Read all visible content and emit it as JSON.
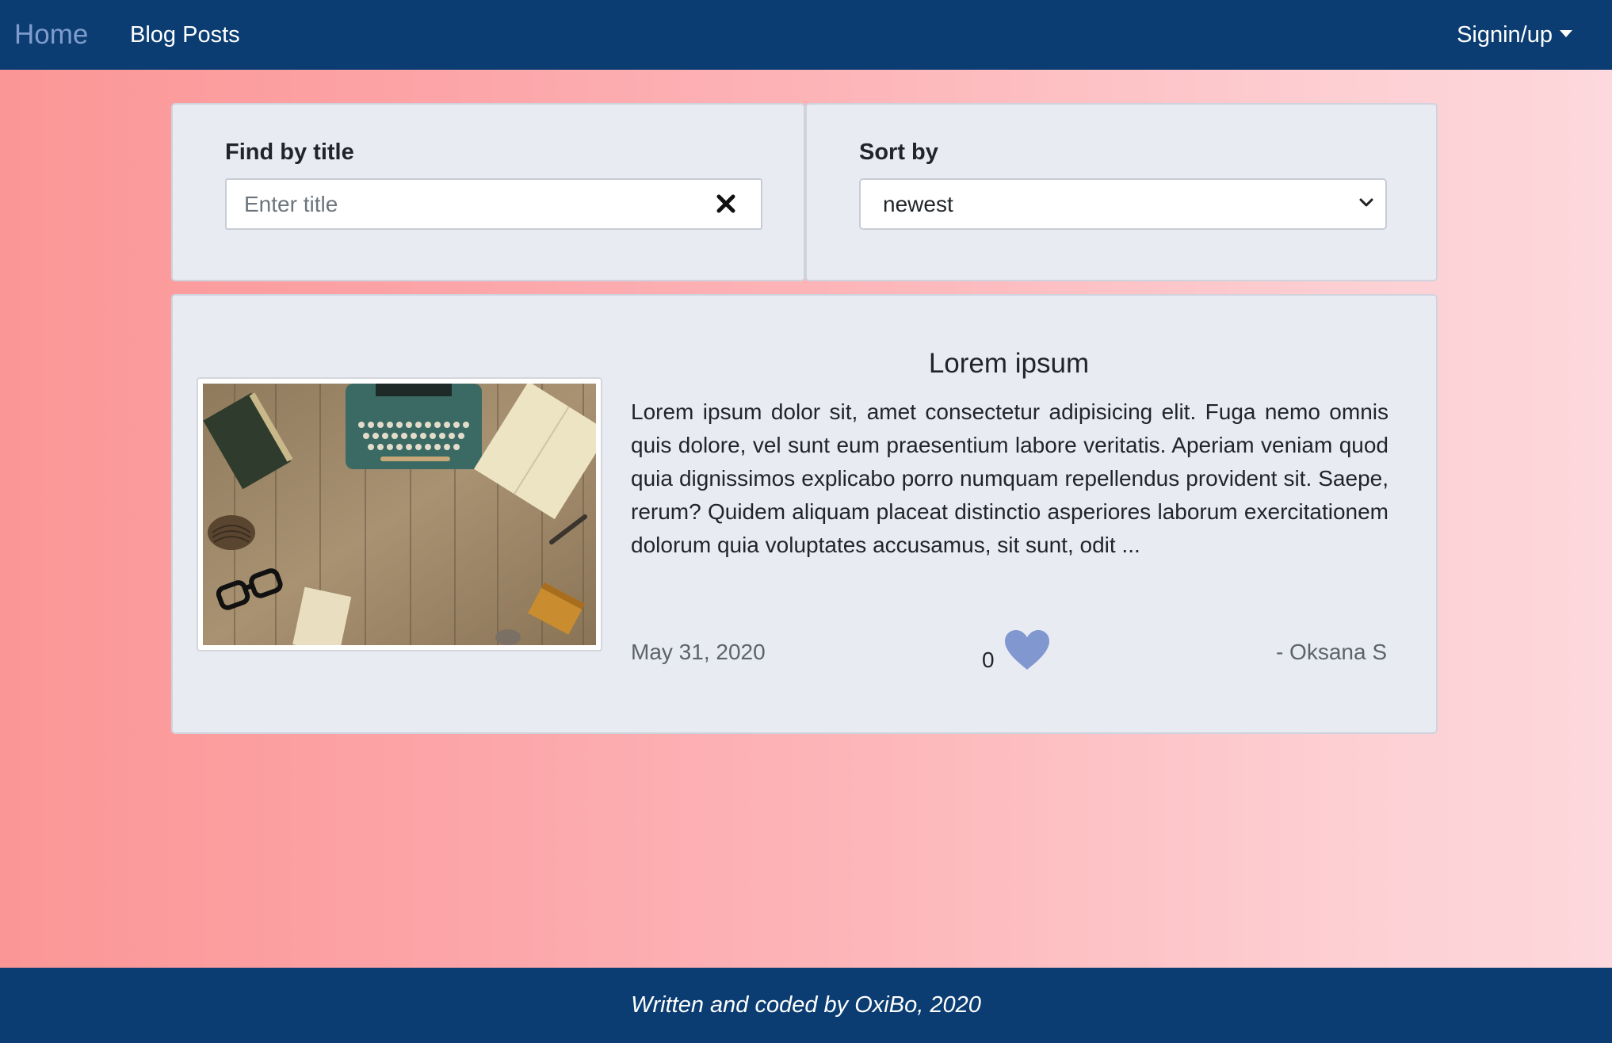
{
  "navbar": {
    "home_label": "Home",
    "posts_label": "Blog Posts",
    "signin_label": "Signin/up"
  },
  "filters": {
    "find_label": "Find by title",
    "find_placeholder": "Enter title",
    "find_value": "",
    "sort_label": "Sort by",
    "sort_value": "newest"
  },
  "post": {
    "title": "Lorem ipsum",
    "excerpt": "Lorem ipsum dolor sit, amet consectetur adipisicing elit. Fuga nemo omnis quis dolore, vel sunt eum praesentium labore veritatis. Aperiam veniam quod quia dignissimos explicabo porro numquam repellendus provident sit. Saepe, rerum? Quidem aliquam placeat distinctio asperiores laborum exercitationem dolorum quia voluptates accusamus, sit sunt, odit ...",
    "date": "May 31, 2020",
    "likes": "0",
    "author": "- Oksana S",
    "image": "typewriter-desk-photo"
  },
  "footer": {
    "text": "Written and coded by OxiBo, 2020"
  },
  "colors": {
    "navbar_bg": "#0b3d72",
    "card_bg": "#e9ebf3",
    "home_link": "#7f9ccd",
    "heart": "#8097cf"
  },
  "icons": {
    "clear": "close-icon",
    "sort_dropdown": "chevron-down-icon",
    "like": "heart-icon",
    "signin_dropdown": "caret-down-icon"
  }
}
